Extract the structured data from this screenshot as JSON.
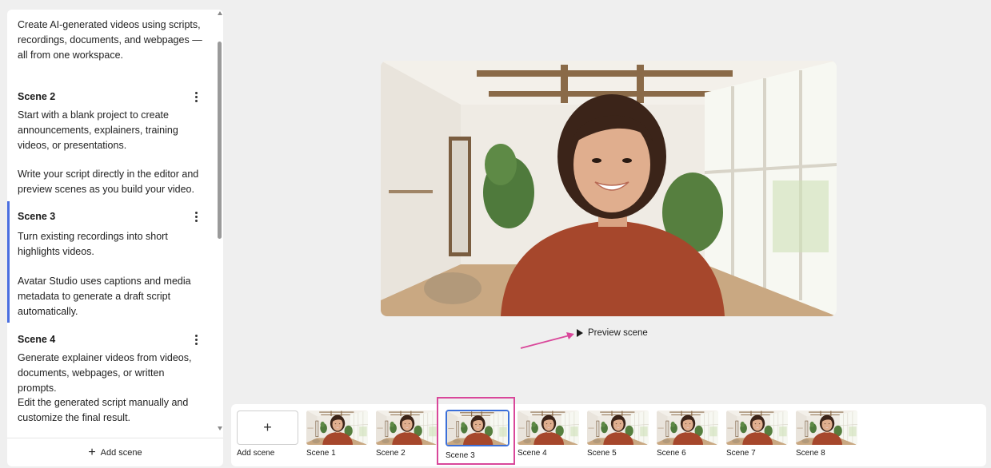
{
  "script_panel": {
    "intro_text": "Create AI-generated videos using scripts, recordings, documents, and webpages — all from one workspace.",
    "scenes": [
      {
        "title": "Scene 2",
        "paragraphs": [
          "Start with a blank project to create announcements, explainers, training videos, or presentations.",
          "Write your script directly in the editor and preview scenes as you build your video."
        ]
      },
      {
        "title": "Scene 3",
        "active": true,
        "paragraphs": [
          "Turn existing recordings into short highlights videos.",
          "Avatar Studio uses captions and media metadata to generate a draft script automatically."
        ]
      },
      {
        "title": "Scene 4",
        "paragraphs": [
          "Generate explainer videos from videos, documents, webpages, or written prompts.",
          "Edit the generated script manually and customize the final result."
        ]
      }
    ],
    "add_scene_label": "Add scene",
    "add_scene_icon": "plus-icon"
  },
  "preview": {
    "button_label": "Preview scene",
    "button_icon": "play-icon"
  },
  "scene_strip": {
    "add_label": "Add scene",
    "add_symbol": "+",
    "scenes": [
      "Scene 1",
      "Scene 2",
      "Scene 3",
      "Scene 4",
      "Scene 5",
      "Scene 6",
      "Scene 7",
      "Scene 8"
    ],
    "selected": "Scene 3"
  },
  "colors": {
    "accent": "#3b6fd9",
    "annotation": "#d9479a",
    "background": "#efefef",
    "panel": "#ffffff"
  }
}
